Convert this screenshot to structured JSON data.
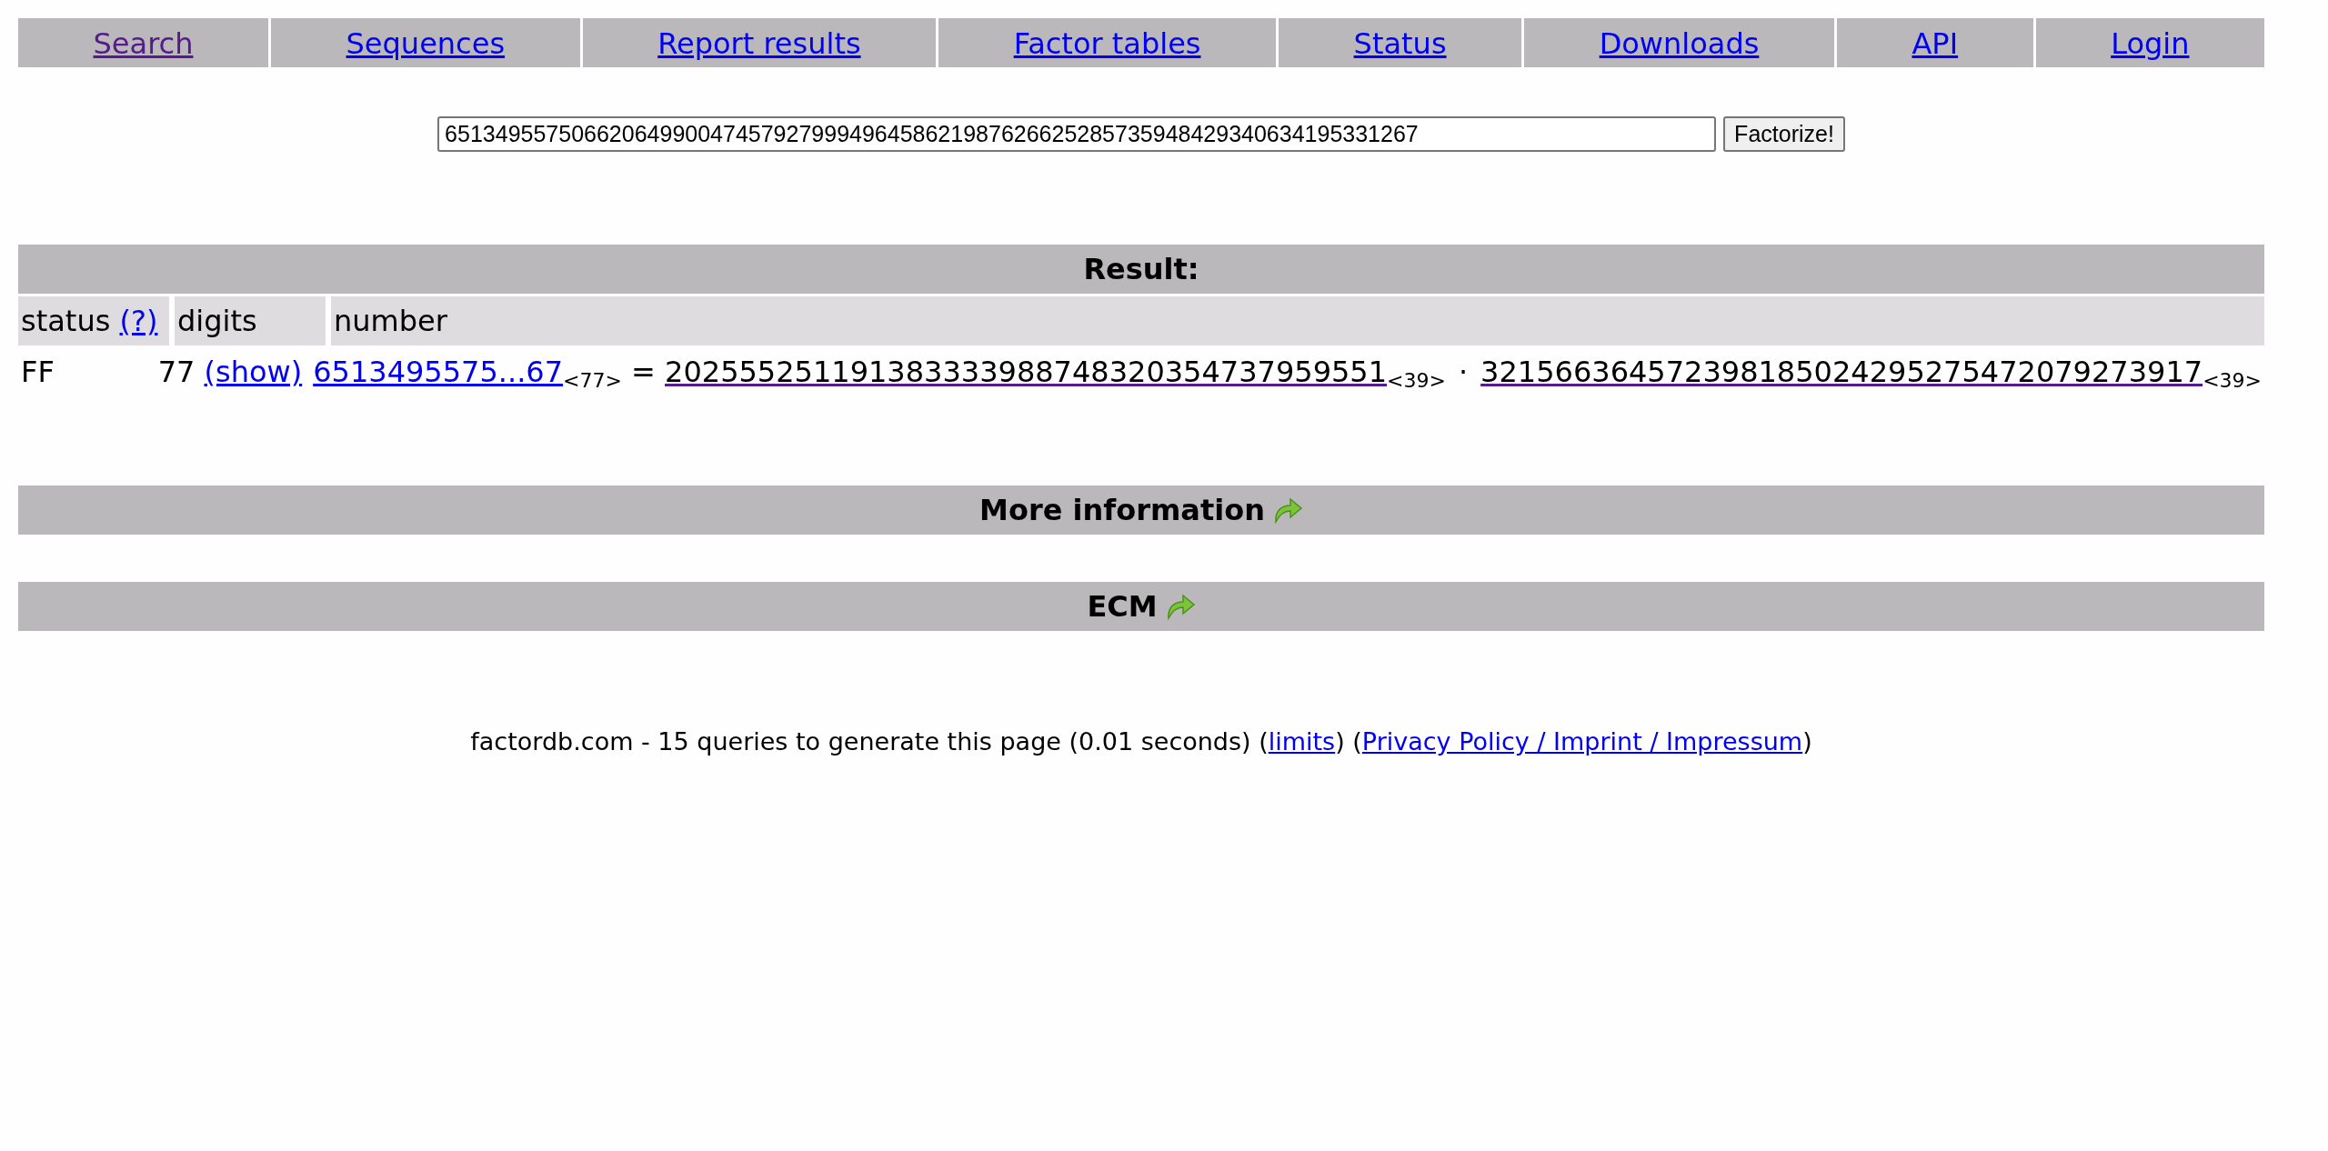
{
  "nav": [
    {
      "label": "Search",
      "visited": true
    },
    {
      "label": "Sequences",
      "visited": false
    },
    {
      "label": "Report results",
      "visited": false
    },
    {
      "label": "Factor tables",
      "visited": false
    },
    {
      "label": "Status",
      "visited": false
    },
    {
      "label": "Downloads",
      "visited": false
    },
    {
      "label": "API",
      "visited": false
    },
    {
      "label": "Login",
      "visited": false
    }
  ],
  "search": {
    "value": "65134955750662064990047457927999496458621987626625285735948429340634195331267",
    "button": "Factorize!"
  },
  "result": {
    "title": "Result:",
    "columns": [
      {
        "label": "status",
        "help_link": "(?)"
      },
      {
        "label": "digits"
      },
      {
        "label": "number"
      }
    ],
    "rows": [
      {
        "status": "FF",
        "digits": "77",
        "show_link": "(show)",
        "number": "6513495575...67",
        "number_digits": "<77>",
        "equals": "=",
        "separator": "·",
        "factors": [
          {
            "value": "202555251191383333988748320354737959551",
            "digits": "<39>"
          },
          {
            "value": "321566364572398185024295275472079273917",
            "digits": "<39>"
          }
        ]
      }
    ]
  },
  "sections": [
    {
      "title": "More information"
    },
    {
      "title": "ECM"
    }
  ],
  "footer": {
    "text": "factordb.com - 15 queries to generate this page (0.01 seconds) (",
    "limits_link": "limits",
    "between": ") (",
    "privacy_link": "Privacy Policy / Imprint / Impressum",
    "end": ")"
  }
}
